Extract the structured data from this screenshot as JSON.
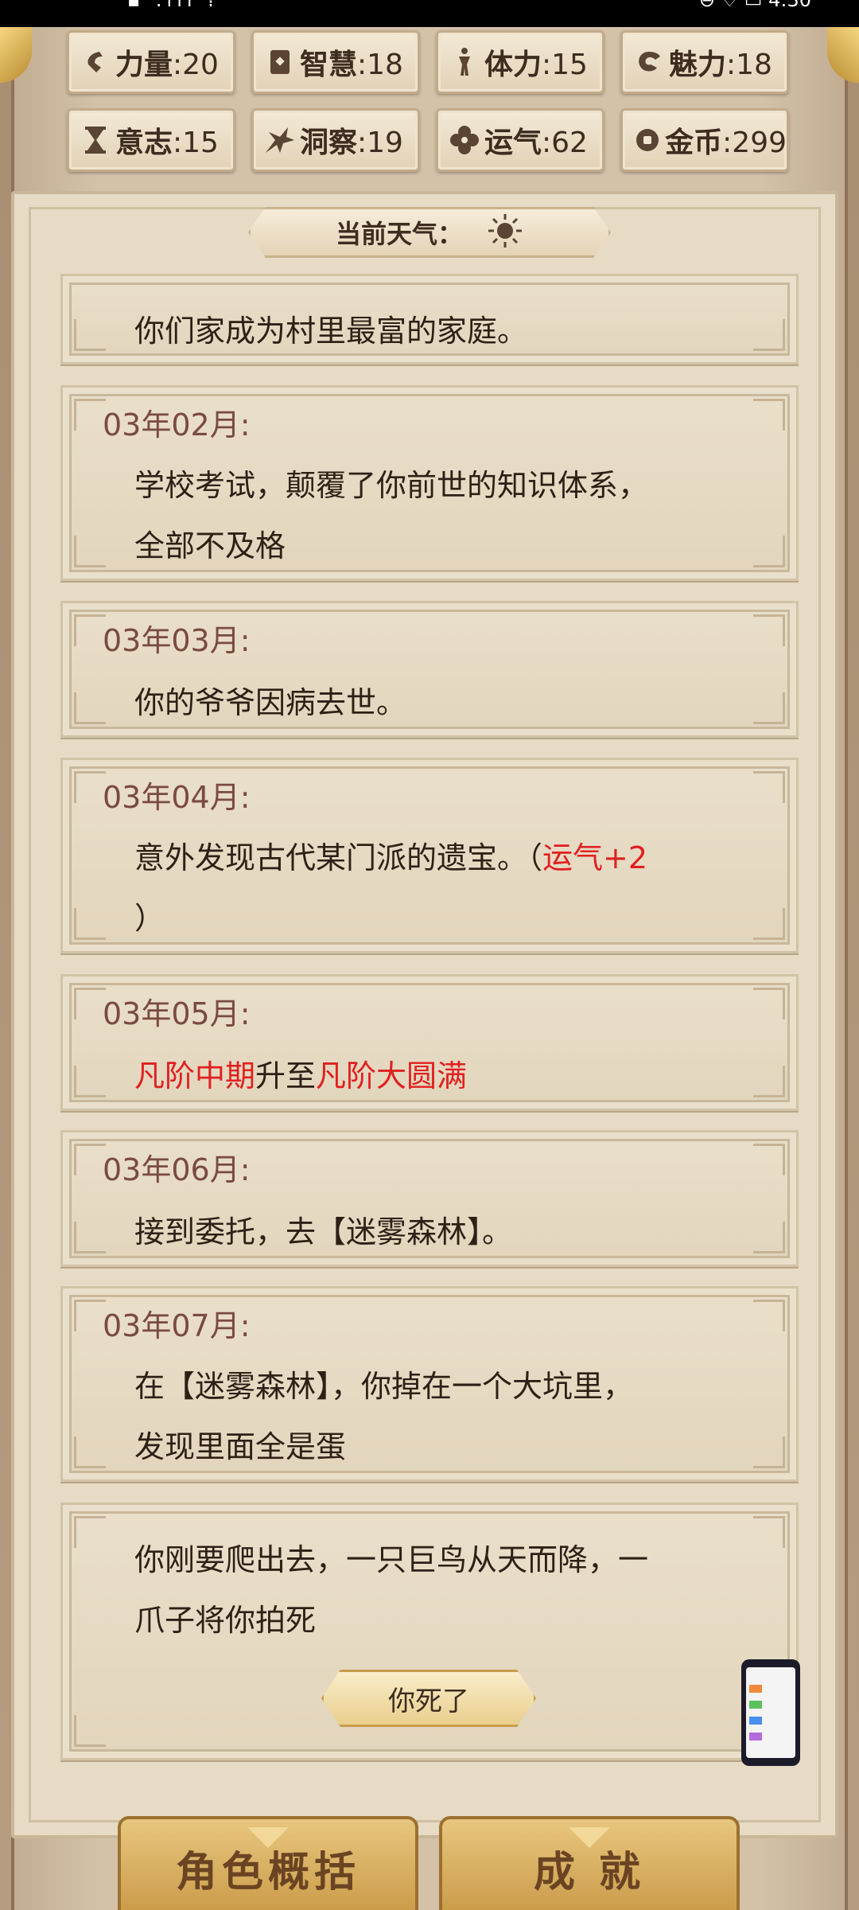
{
  "status_bar": {
    "left": "▪ .ııl ⁞",
    "right": "⊖ ♡ ▭ 4:30"
  },
  "stats": [
    {
      "icon": "strength-icon",
      "label": "力量",
      "value": ":20"
    },
    {
      "icon": "wisdom-icon",
      "label": "智慧",
      "value": ":18"
    },
    {
      "icon": "stamina-icon",
      "label": "体力",
      "value": ":15"
    },
    {
      "icon": "charm-icon",
      "label": "魅力",
      "value": ":18"
    },
    {
      "icon": "will-icon",
      "label": "意志",
      "value": ":15"
    },
    {
      "icon": "insight-icon",
      "label": "洞察",
      "value": ":19"
    },
    {
      "icon": "luck-icon",
      "label": "运气",
      "value": ":62"
    },
    {
      "icon": "gold-coin-icon",
      "label": "金币",
      "value": ":299"
    }
  ],
  "weather": {
    "label": "当前天气：",
    "icon": "sun-icon"
  },
  "entries": [
    {
      "date": "",
      "lines": [
        "你们家成为村里最富的家庭。"
      ]
    },
    {
      "date": "03年02月:",
      "lines": [
        "学校考试，颠覆了你前世的知识体系，",
        "全部不及格"
      ]
    },
    {
      "date": "03年03月:",
      "lines": [
        "你的爷爷因病去世。"
      ]
    },
    {
      "date": "03年04月:",
      "line1_prefix": "意外发现古代某门派的遗宝。（",
      "line1_red": "运气+2",
      "line2": "）"
    },
    {
      "date": "03年05月:",
      "red1": "凡阶中期",
      "mid": "升至",
      "red2": "凡阶大圆满"
    },
    {
      "date": "03年06月:",
      "lines": [
        "接到委托，去【迷雾森林】。"
      ]
    },
    {
      "date": "03年07月:",
      "lines": [
        "在【迷雾森林】，你掉在一个大坑里，",
        "发现里面全是蛋"
      ]
    },
    {
      "date": "",
      "lines": [
        "你刚要爬出去，一只巨鸟从天而降，一",
        "爪子将你拍死"
      ]
    }
  ],
  "death_button": "你死了",
  "bottom_buttons": {
    "summary": "角色概括",
    "achievements": "成 就"
  },
  "colors": {
    "highlight_red": "#e02020",
    "date_brown": "#7a4b3f",
    "gold": "#d9b162"
  }
}
